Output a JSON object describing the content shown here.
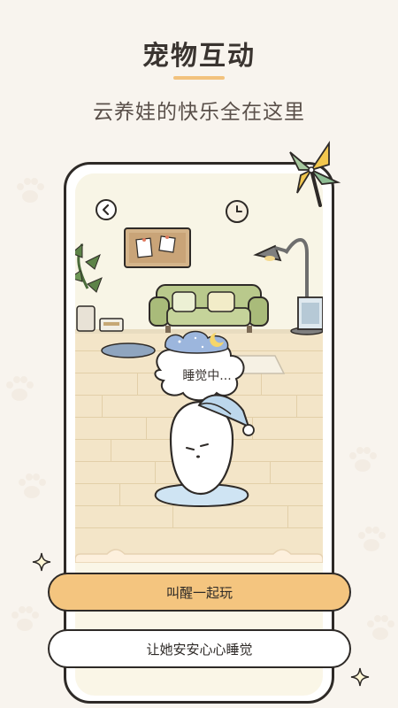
{
  "header": {
    "title": "宠物互动",
    "subtitle": "云养娃的快乐全在这里"
  },
  "scene": {
    "status_bubble": "睡觉中..."
  },
  "actions": {
    "wake_label": "叫醒一起玩",
    "sleep_label": "让她安安心心睡觉"
  },
  "colors": {
    "background": "#f8f4ee",
    "accent": "#f4c57f",
    "outline": "#2e2a27",
    "sofa": "#b9c98c"
  },
  "icons": [
    "back-arrow-icon",
    "clock-icon",
    "pinwheel-icon",
    "sparkle-icon",
    "paw-icon"
  ]
}
